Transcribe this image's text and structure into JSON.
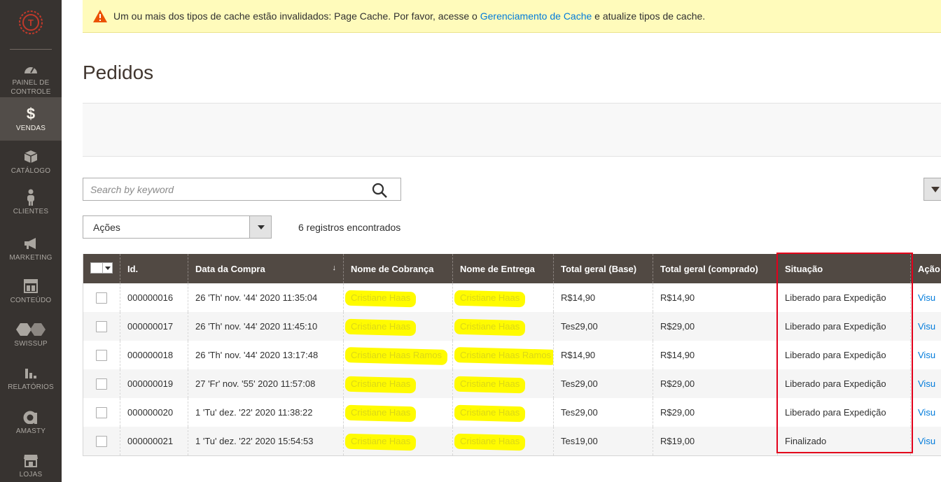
{
  "notice": {
    "text_before": "Um ou mais dos tipos de cache estão invalidados: Page Cache. Por favor, acesse o ",
    "link": "Gerenciamento de Cache",
    "text_after": " e atualize tipos de cache."
  },
  "sidebar": {
    "items": [
      {
        "label": "PAINEL DE CONTROLE",
        "icon": "dashboard-icon"
      },
      {
        "label": "VENDAS",
        "icon": "dollar-icon"
      },
      {
        "label": "CATÁLOGO",
        "icon": "box-icon"
      },
      {
        "label": "CLIENTES",
        "icon": "person-icon"
      },
      {
        "label": "MARKETING",
        "icon": "megaphone-icon"
      },
      {
        "label": "CONTEÚDO",
        "icon": "layout-icon"
      },
      {
        "label": "SWISSUP",
        "icon": "swissup-icon"
      },
      {
        "label": "RELATÓRIOS",
        "icon": "bar-chart-icon"
      },
      {
        "label": "AMASTY",
        "icon": "amasty-icon"
      },
      {
        "label": "LOJAS",
        "icon": "store-icon"
      }
    ]
  },
  "page_title": "Pedidos",
  "search": {
    "placeholder": "Search by keyword"
  },
  "actions": {
    "label": "Ações"
  },
  "records_found": "6 registros encontrados",
  "grid": {
    "columns": [
      "Id.",
      "Data da Compra",
      "Nome de Cobrança",
      "Nome de Entrega",
      "Total geral (Base)",
      "Total geral (comprado)",
      "Situação",
      "Ação"
    ],
    "sort_indicator": "↓",
    "view_label": "Visu",
    "rows": [
      {
        "id": "000000016",
        "date": "26 'Th' nov. '44' 2020 11:35:04",
        "billing": "Cristiane Haas",
        "shipping": "Cristiane Haas",
        "base": "R$14,90",
        "purchased": "R$14,90",
        "status": "Liberado para Expedição"
      },
      {
        "id": "000000017",
        "date": "26 'Th' nov. '44' 2020 11:45:10",
        "billing": "Cristiane Haas",
        "shipping": "Cristiane Haas",
        "base": "Tes29,00",
        "purchased": "R$29,00",
        "status": "Liberado para Expedição"
      },
      {
        "id": "000000018",
        "date": "26 'Th' nov. '44' 2020 13:17:48",
        "billing": "Cristiane Haas Ramos",
        "shipping": "Cristiane Haas Ramos",
        "base": "R$14,90",
        "purchased": "R$14,90",
        "status": "Liberado para Expedição"
      },
      {
        "id": "000000019",
        "date": "27 'Fr' nov. '55' 2020 11:57:08",
        "billing": "Cristiane Haas",
        "shipping": "Cristiane Haas",
        "base": "Tes29,00",
        "purchased": "R$29,00",
        "status": "Liberado para Expedição"
      },
      {
        "id": "000000020",
        "date": "1 'Tu' dez. '22' 2020 11:38:22",
        "billing": "Cristiane Haas",
        "shipping": "Cristiane Haas",
        "base": "Tes29,00",
        "purchased": "R$29,00",
        "status": "Liberado para Expedição"
      },
      {
        "id": "000000021",
        "date": "1 'Tu' dez. '22' 2020 15:54:53",
        "billing": "Cristiane Haas",
        "shipping": "Cristiane Haas",
        "base": "Tes19,00",
        "purchased": "R$19,00",
        "status": "Finalizado"
      }
    ]
  },
  "colors": {
    "sidebar": "#373330",
    "header": "#514943",
    "notice": "#fffbbb",
    "link": "#007bdb",
    "highlight": "#fffb00",
    "annotation": "#e3001b"
  }
}
